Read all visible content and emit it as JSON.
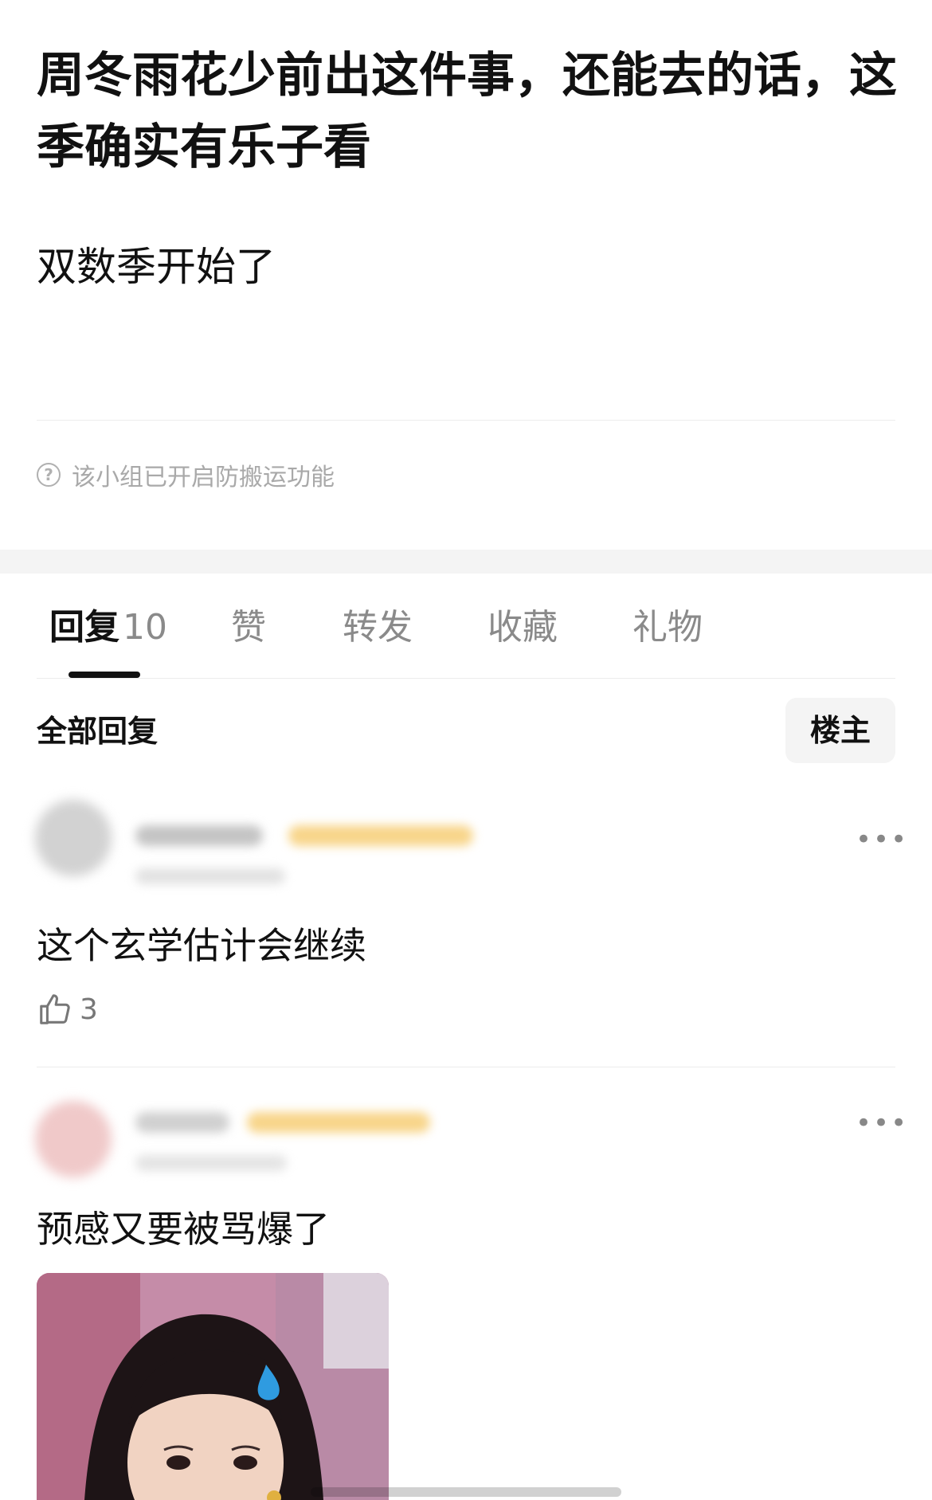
{
  "post": {
    "title": "周冬雨花少前出这件事，还能去的话，这季确实有乐子看",
    "body": "双数季开始了",
    "notice": "该小组已开启防搬运功能",
    "notice_icon": "help-circle-icon"
  },
  "tabs": [
    {
      "label": "回复",
      "count": "10",
      "active": true
    },
    {
      "label": "赞",
      "count": "",
      "active": false
    },
    {
      "label": "转发",
      "count": "",
      "active": false
    },
    {
      "label": "收藏",
      "count": "",
      "active": false
    },
    {
      "label": "礼物",
      "count": "",
      "active": false
    }
  ],
  "filter": {
    "all_replies": "全部回复",
    "op_only": "楼主"
  },
  "comments": [
    {
      "text": "这个玄学估计会继续",
      "likes": "3",
      "more": "•••"
    },
    {
      "text": "预感又要被骂爆了",
      "more": "•••",
      "image_icon": "reaction-image-icon"
    }
  ],
  "colors": {
    "text_primary": "#111111",
    "text_secondary": "#8a8a8a",
    "section_gap": "#f4f4f4",
    "blurred_badge": "#f8d58a"
  }
}
